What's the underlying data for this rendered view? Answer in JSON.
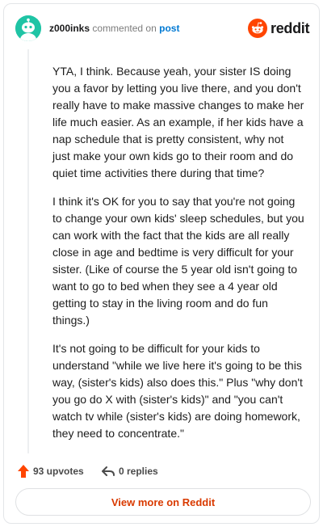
{
  "header": {
    "username": "z000inks",
    "action_text": "commented on",
    "post_link": "post",
    "brand": "reddit"
  },
  "comment": {
    "paragraphs": [
      "YTA, I think. Because yeah, your sister IS doing you a favor by letting you live there, and you don't really have to make massive changes to make her life much easier. As an example, if her kids have a nap schedule that is pretty consistent, why not just make your own kids go to their room and do quiet time activities there during that time?",
      "I think it's OK for you to say that you're not going to change your own kids' sleep schedules, but you can work with the fact that the kids are all really close in age and bedtime is very difficult for your sister. (Like of course the 5 year old isn't going to want to go to bed when they see a 4 year old getting to stay in the living room and do fun things.)",
      "It's not going to be difficult for your kids to understand \"while we live here it's going to be this way, (sister's kids) also does this.\" Plus \"why don't you go do X with (sister's kids)\" and \"you can't watch tv while (sister's kids) are doing homework, they need to concentrate.\""
    ]
  },
  "footer": {
    "upvotes_label": "93 upvotes",
    "replies_label": "0 replies",
    "view_more_label": "View more on Reddit"
  },
  "colors": {
    "brand_orange": "#ff4500",
    "avatar_teal": "#1fc4a5",
    "link_blue": "#0079d3",
    "view_more_text": "#d93a00"
  },
  "icons": [
    "avatar-icon",
    "reddit-logo-icon",
    "upvote-arrow-icon",
    "reply-arrow-icon"
  ]
}
